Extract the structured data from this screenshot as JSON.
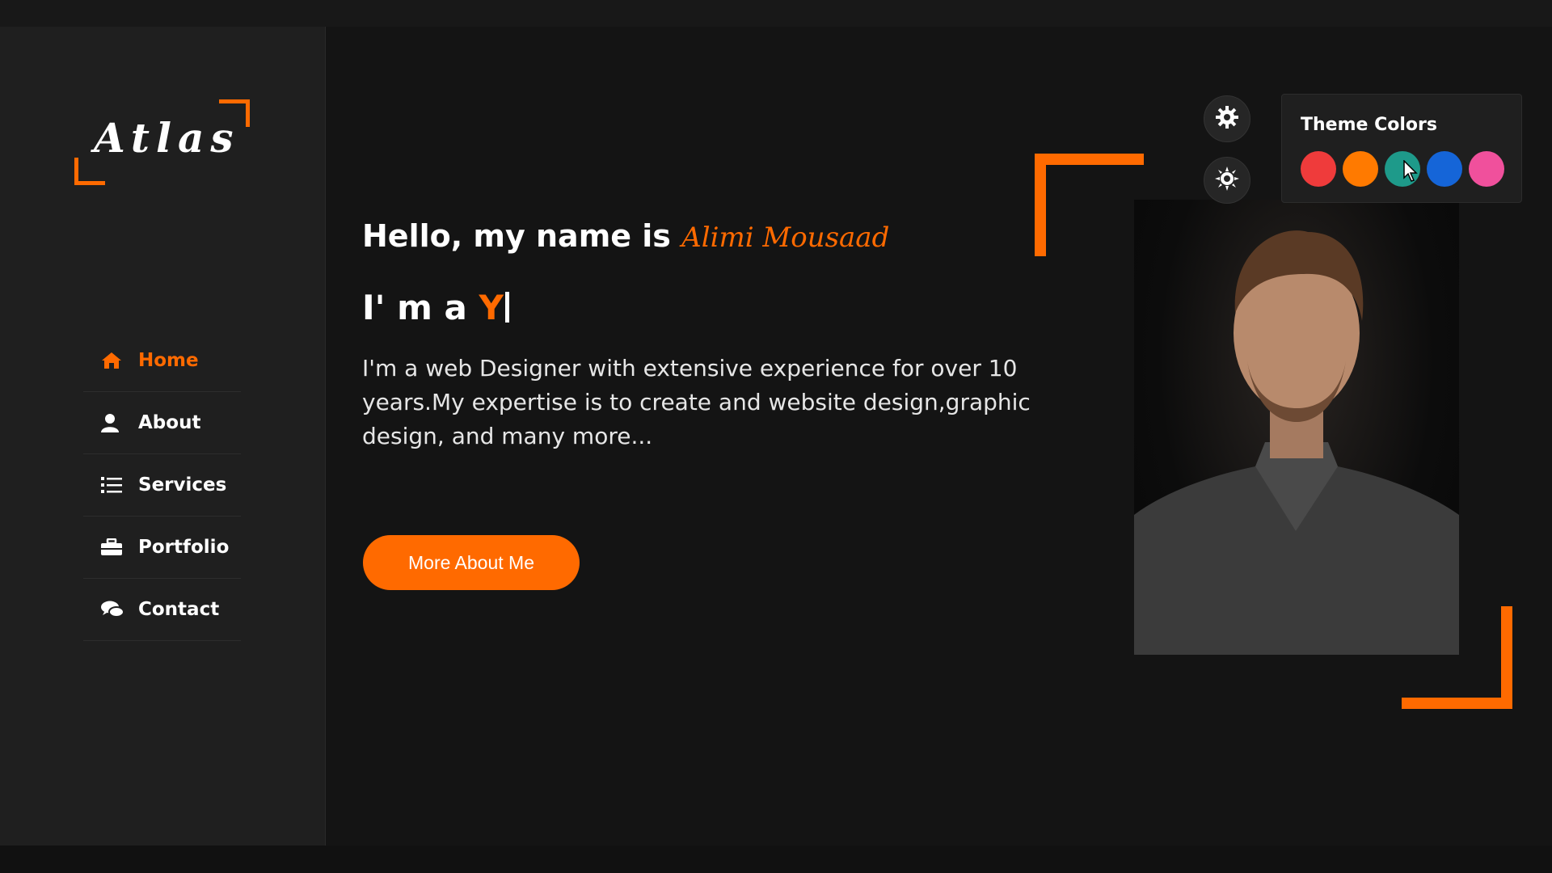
{
  "theme": {
    "accent": "#ff6a00"
  },
  "logo": {
    "text": "Atlas"
  },
  "nav": {
    "items": [
      {
        "label": "Home",
        "icon": "home-icon",
        "active": true
      },
      {
        "label": "About",
        "icon": "user-icon",
        "active": false
      },
      {
        "label": "Services",
        "icon": "list-icon",
        "active": false
      },
      {
        "label": "Portfolio",
        "icon": "briefcase-icon",
        "active": false
      },
      {
        "label": "Contact",
        "icon": "chat-icon",
        "active": false
      }
    ]
  },
  "hero": {
    "greeting_prefix": "Hello, my name is ",
    "name": "Alimi Mousaad",
    "role_prefix": "I' m a ",
    "role_typed": "Y",
    "description": "I'm a web Designer with extensive experience for over 10 years.My expertise is to create and website design,graphic design, and many more...",
    "cta_label": "More About Me"
  },
  "settings": {
    "gear_icon": "gear-icon",
    "theme_toggle_icon": "sun-icon"
  },
  "theme_panel": {
    "title": "Theme Colors",
    "colors": [
      "#ef3b3b",
      "#ff7a00",
      "#1e9a8a",
      "#1565d8",
      "#f0509c"
    ]
  }
}
